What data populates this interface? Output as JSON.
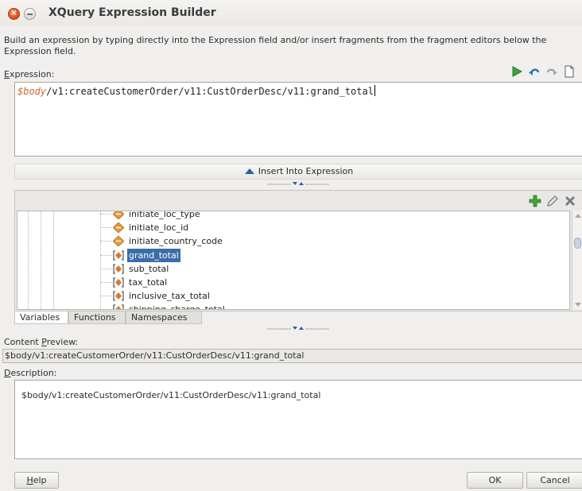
{
  "window": {
    "title": "XQuery Expression Builder",
    "close_icon": "close-icon",
    "minimize_icon": "minimize-icon"
  },
  "intro": {
    "text": "Build an expression by typing directly into the Expression field and/or insert fragments from the fragment editors below the Expression field."
  },
  "expression": {
    "label_first": "E",
    "label_rest": "xpression:",
    "variable": "$body",
    "path": "/v1:createCustomerOrder/v11:CustOrderDesc/v11:grand_total",
    "toolbar_icons": [
      "run-icon",
      "undo-icon",
      "redo-icon",
      "new-document-icon"
    ]
  },
  "insert_bar": {
    "label": "Insert Into Expression",
    "icon": "up-arrow-icon"
  },
  "tree": {
    "tool_icons": [
      "add-icon",
      "edit-icon",
      "delete-icon"
    ],
    "items": [
      {
        "label": "initiate_loc_type",
        "icon": "element-icon"
      },
      {
        "label": "initiate_loc_id",
        "icon": "element-icon"
      },
      {
        "label": "initiate_country_code",
        "icon": "element-icon"
      },
      {
        "label": "grand_total",
        "icon": "variable-element-icon"
      },
      {
        "label": "sub_total",
        "icon": "variable-element-icon"
      },
      {
        "label": "tax_total",
        "icon": "variable-element-icon"
      },
      {
        "label": "inclusive_tax_total",
        "icon": "variable-element-icon"
      },
      {
        "label": "shipping_charge_total",
        "icon": "variable-element-icon"
      }
    ],
    "selected": "grand_total"
  },
  "tabs": [
    {
      "label": "Variables",
      "active": true
    },
    {
      "label": "Functions",
      "active": false
    },
    {
      "label": "Namespaces",
      "active": false
    }
  ],
  "preview": {
    "label_pre": "Content ",
    "label_ul": "P",
    "label_post": "review:",
    "value": "$body/v1:createCustomerOrder/v11:CustOrderDesc/v11:grand_total"
  },
  "description": {
    "label_ul": "D",
    "label_rest": "escription:",
    "value": "$body/v1:createCustomerOrder/v11:CustOrderDesc/v11:grand_total"
  },
  "buttons": {
    "help_ul": "H",
    "help_rest": "elp",
    "ok": "OK",
    "cancel": "Cancel"
  },
  "colors": {
    "selection": "#3b6ea9",
    "variable_text": "#c86b2e",
    "run_green": "#3aa53a"
  }
}
